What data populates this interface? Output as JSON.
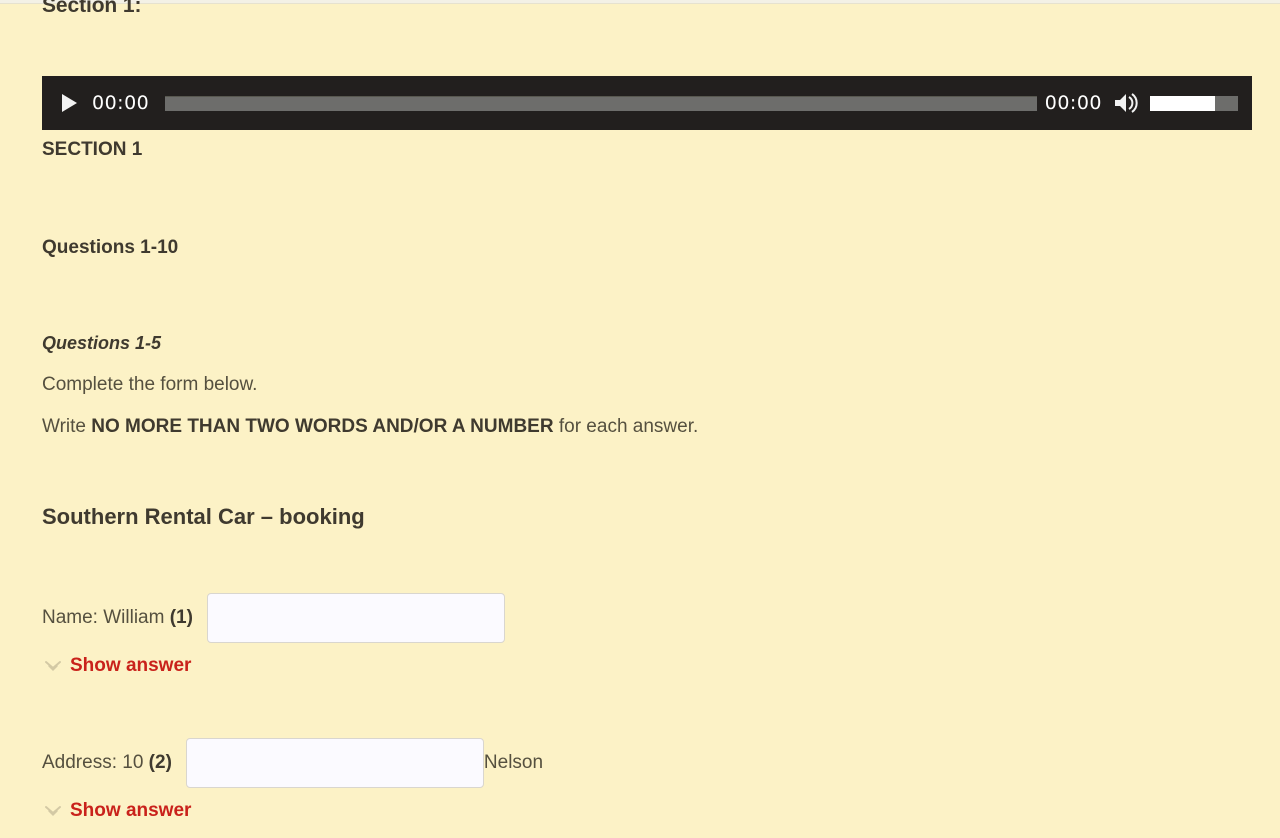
{
  "page": {
    "background_color": "#fcf2c6",
    "section_label": "Section 1:"
  },
  "audio_player": {
    "play_icon": "play-triangle-icon",
    "current_time": "00:00",
    "duration": "00:00",
    "progress_percent": 0,
    "volume_icon": "speaker-volume-icon",
    "volume_percent": 74,
    "background_color": "#221f1e"
  },
  "content": {
    "section_heading": "SECTION 1",
    "questions_range": "Questions 1-10",
    "questions_sub": "Questions 1-5",
    "instruction_line1": "Complete the form below.",
    "instruction_prefix": "Write ",
    "instruction_emphasis": "NO MORE THAN TWO WORDS AND/OR A NUMBER",
    "instruction_suffix": " for each answer.",
    "form_title": "Southern Rental Car – booking"
  },
  "form": {
    "rows": [
      {
        "label_prefix": "Name: William ",
        "label_number": "(1)",
        "input_value": "",
        "input_placeholder": "",
        "suffix": "",
        "show_answer_label": "Show answer",
        "chevron_icon": "chevron-down-icon"
      },
      {
        "label_prefix": "Address: 10 ",
        "label_number": "(2)",
        "input_value": "",
        "input_placeholder": "",
        "suffix": "Nelson",
        "show_answer_label": "Show answer",
        "chevron_icon": "chevron-down-icon"
      }
    ]
  },
  "colors": {
    "accent_red": "#c9221b",
    "text_dark": "#3f3a2f",
    "text_body": "#55503f",
    "input_bg": "#fbfaff",
    "input_border": "#d9d6cf"
  }
}
